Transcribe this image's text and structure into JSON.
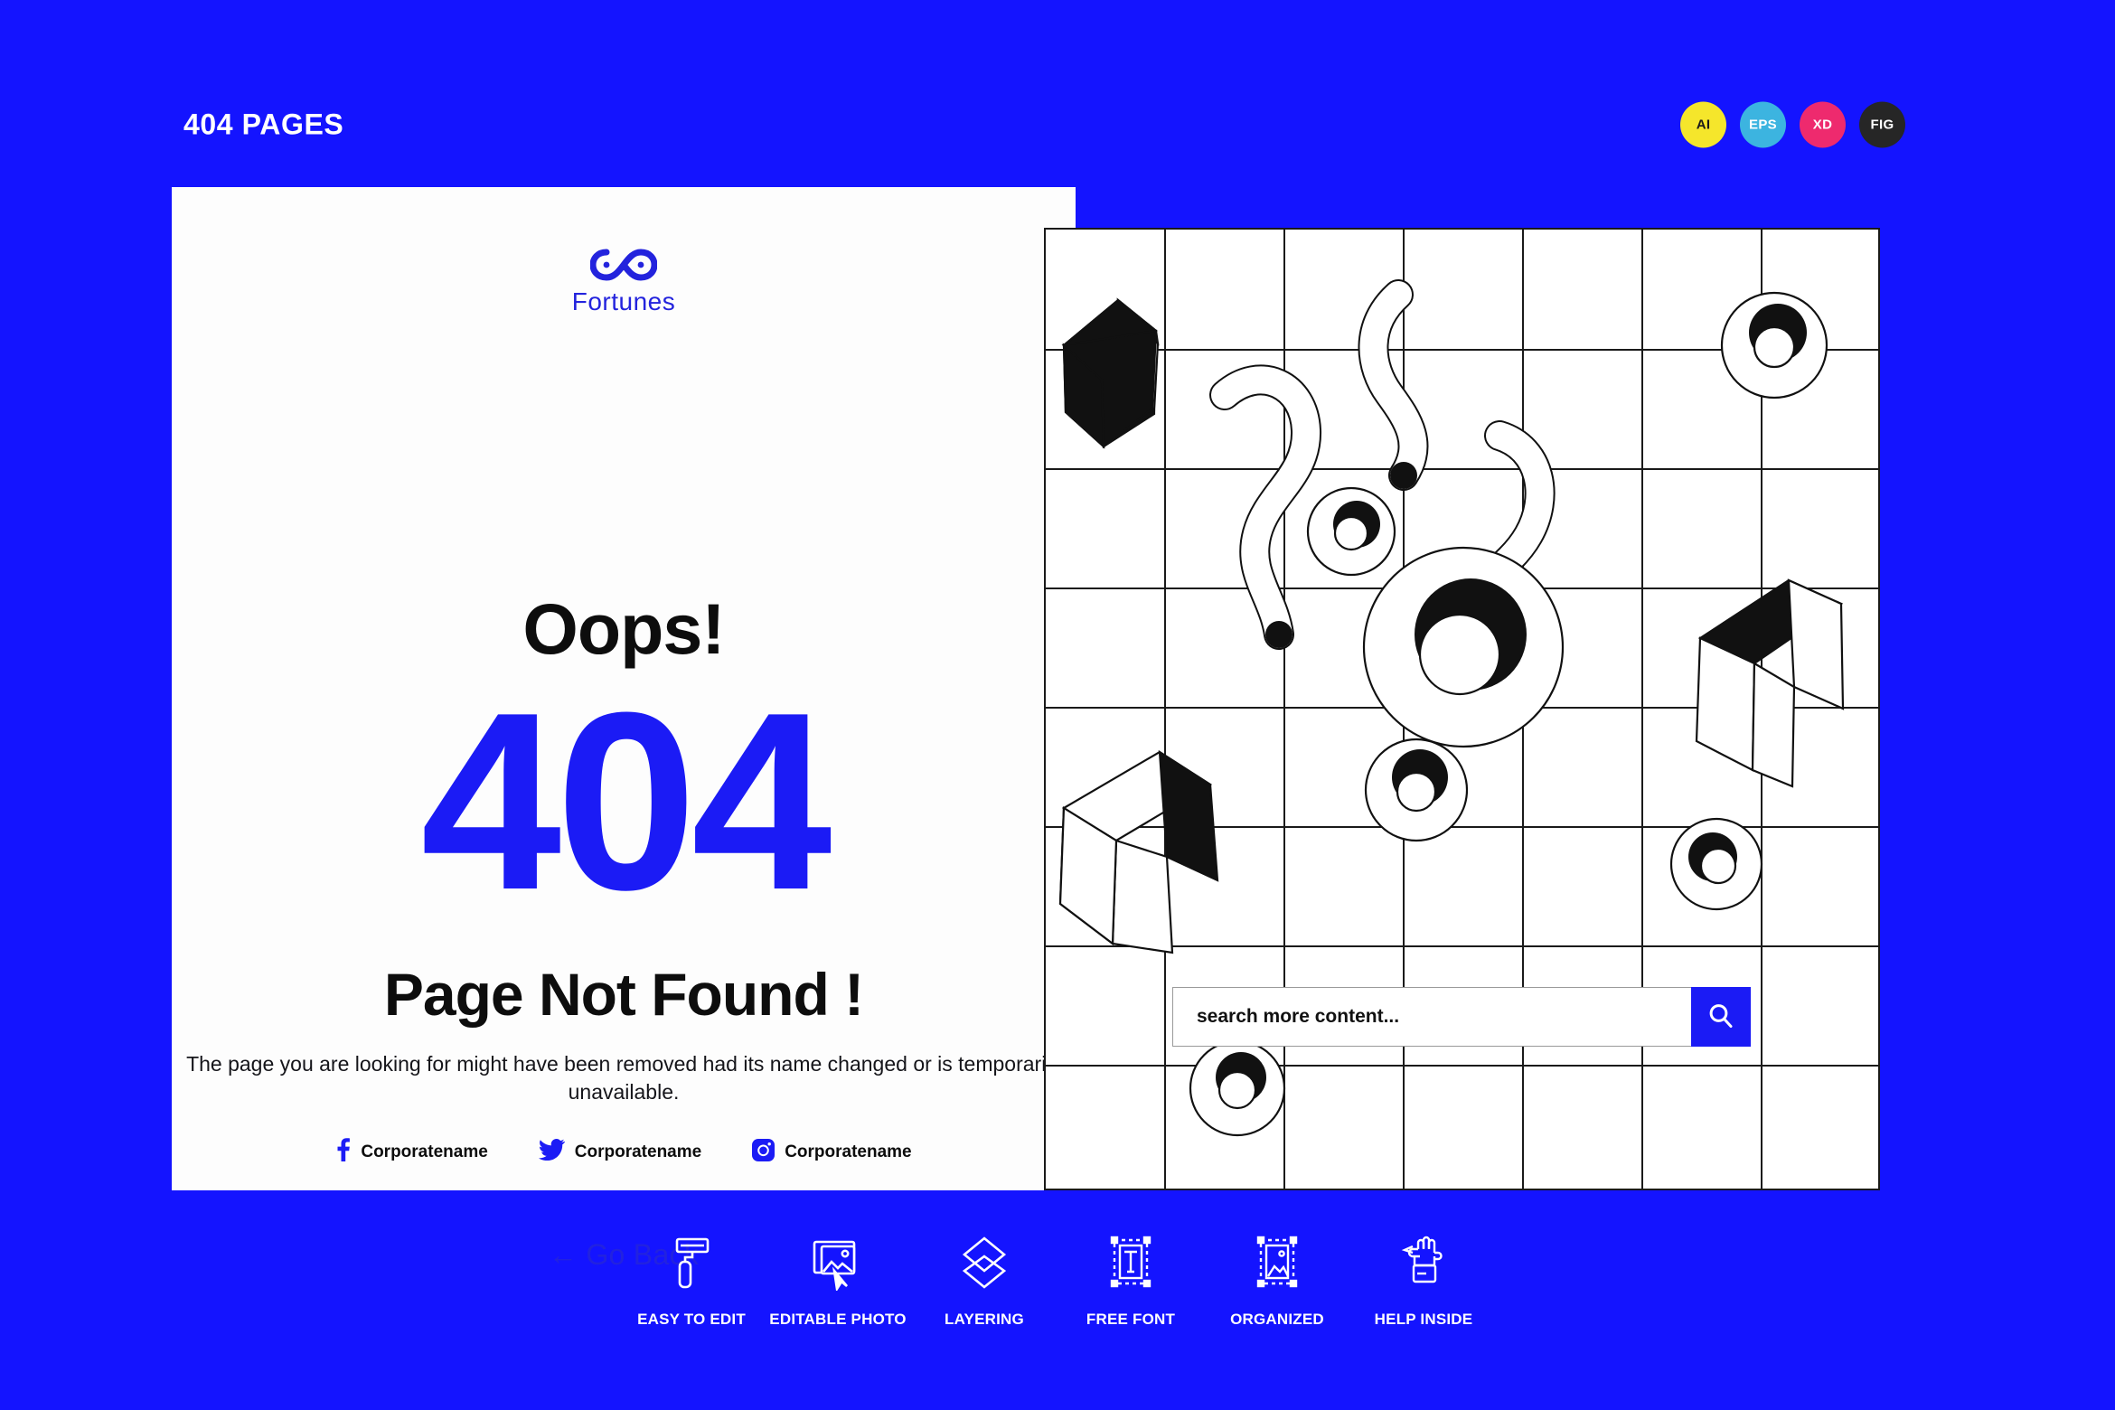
{
  "theme": {
    "background": "#1414ff",
    "accent_blue": "#1b1bf5",
    "card_background": "#fdfdfd",
    "text_dark": "#0d0d0d",
    "text_white": "#ffffff"
  },
  "header": {
    "title": "404 PAGES",
    "badges": [
      {
        "label": "AI",
        "bg": "#f5e62b",
        "fg": "#1a1a1a"
      },
      {
        "label": "EPS",
        "bg": "#3cb4e0",
        "fg": "#ffffff"
      },
      {
        "label": "XD",
        "bg": "#ee2a6e",
        "fg": "#ffffff"
      },
      {
        "label": "FIG",
        "bg": "#262626",
        "fg": "#ffffff"
      }
    ]
  },
  "card": {
    "logo": {
      "icon": "infinity-icon",
      "text": "Fortunes",
      "color": "#2323dd"
    },
    "oops": "Oops!",
    "error_code": "404",
    "heading": "Page Not Found !",
    "description": "The page you are looking for might have been removed had its name changed or is temporarily unavailable.",
    "socials": [
      {
        "icon": "facebook-icon",
        "label": "Corporatename"
      },
      {
        "icon": "twitter-icon",
        "label": "Corporatename"
      },
      {
        "icon": "instagram-icon",
        "label": "Corporatename"
      }
    ],
    "go_back": "← Go Back"
  },
  "illustration": {
    "search": {
      "placeholder": "search more content...",
      "value": "",
      "button_icon": "search-icon",
      "button_color": "#1b1bf5"
    },
    "grid": {
      "columns": 7,
      "rows": 8,
      "line_color": "#1a1a1a"
    },
    "shapes": [
      {
        "type": "cube",
        "variant": "black-body"
      },
      {
        "type": "cube",
        "variant": "white-body"
      },
      {
        "type": "cube",
        "variant": "black-top"
      },
      {
        "type": "eye-circle",
        "size": "small"
      },
      {
        "type": "eye-circle",
        "size": "large"
      },
      {
        "type": "eye-circle",
        "size": "medium"
      },
      {
        "type": "eye-circle",
        "size": "medium"
      },
      {
        "type": "eye-circle",
        "size": "small"
      },
      {
        "type": "squiggle",
        "variant": "pin-bottom"
      },
      {
        "type": "squiggle",
        "variant": "pin-bottom"
      },
      {
        "type": "squiggle",
        "variant": "open"
      }
    ]
  },
  "features": [
    {
      "icon": "paint-roller-icon",
      "label": "EASY TO EDIT"
    },
    {
      "icon": "editable-photo-icon",
      "label": "EDITABLE PHOTO"
    },
    {
      "icon": "layers-icon",
      "label": "LAYERING"
    },
    {
      "icon": "free-font-icon",
      "label": "FREE FONT"
    },
    {
      "icon": "organized-icon",
      "label": "ORGANIZED"
    },
    {
      "icon": "help-hand-icon",
      "label": "HELP INSIDE"
    }
  ]
}
